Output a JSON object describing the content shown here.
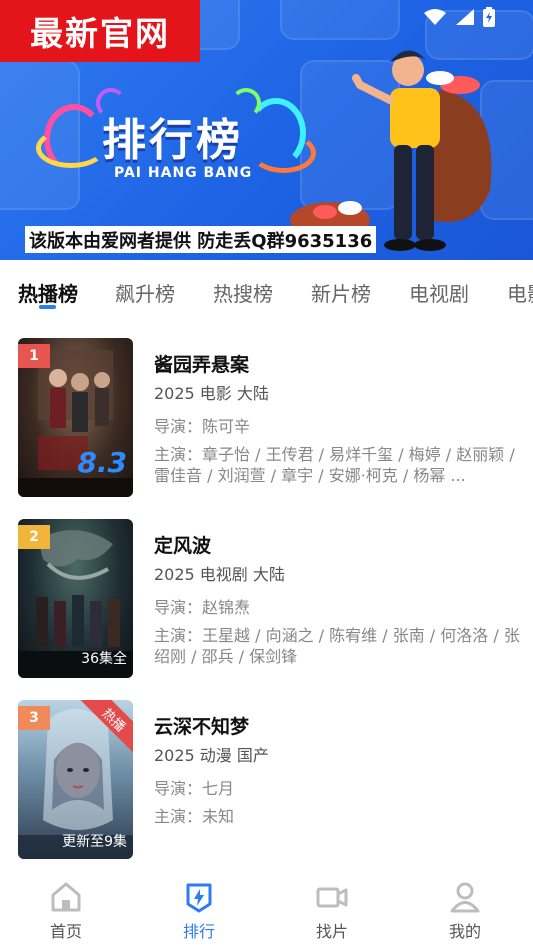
{
  "site_badge": "最新官网",
  "banner": {
    "title": "排行榜",
    "subtitle": "PAI HANG BANG",
    "notice": "该版本由爱网者提供 防走丢Q群9635136"
  },
  "tabs": [
    {
      "label": "热播榜",
      "active": true
    },
    {
      "label": "飙升榜",
      "active": false
    },
    {
      "label": "热搜榜",
      "active": false
    },
    {
      "label": "新片榜",
      "active": false
    },
    {
      "label": "电视剧",
      "active": false
    },
    {
      "label": "电影",
      "active": false
    }
  ],
  "list": [
    {
      "rank": "1",
      "rank_color": "#e8554e",
      "title": "酱园弄悬案",
      "meta": "2025  电影  大陆",
      "director": "导演：陈可辛",
      "cast": "主演：章子怡 / 王传君 / 易烊千玺 / 梅婷 / 赵丽颖 / 雷佳音 / 刘润萱 / 章宇 / 安娜·柯克 / 杨幂 ...",
      "score": "8.3"
    },
    {
      "rank": "2",
      "rank_color": "#f0b53a",
      "title": "定风波",
      "meta": "2025  电视剧  大陆",
      "director": "导演：赵锦焘",
      "cast": "主演：王星越 / 向涵之 / 陈宥维 / 张南 / 何洛洛 / 张绍刚 / 邵兵 / 保剑锋",
      "poster_note": "36集全"
    },
    {
      "rank": "3",
      "rank_color": "#f08a5a",
      "title": "云深不知梦",
      "meta": "2025  动漫  国产",
      "director": "导演：七月",
      "cast": "主演：未知",
      "poster_note": "更新至9集",
      "corner_tag": "热播"
    }
  ],
  "nav": [
    {
      "label": "首页",
      "icon": "home-icon",
      "active": false
    },
    {
      "label": "排行",
      "icon": "ranking-icon",
      "active": true
    },
    {
      "label": "找片",
      "icon": "video-camera-icon",
      "active": false
    },
    {
      "label": "我的",
      "icon": "user-icon",
      "active": false
    }
  ],
  "colors": {
    "accent": "#2f7bf0",
    "banner": "#1d63e4",
    "badge": "#e4141b"
  }
}
